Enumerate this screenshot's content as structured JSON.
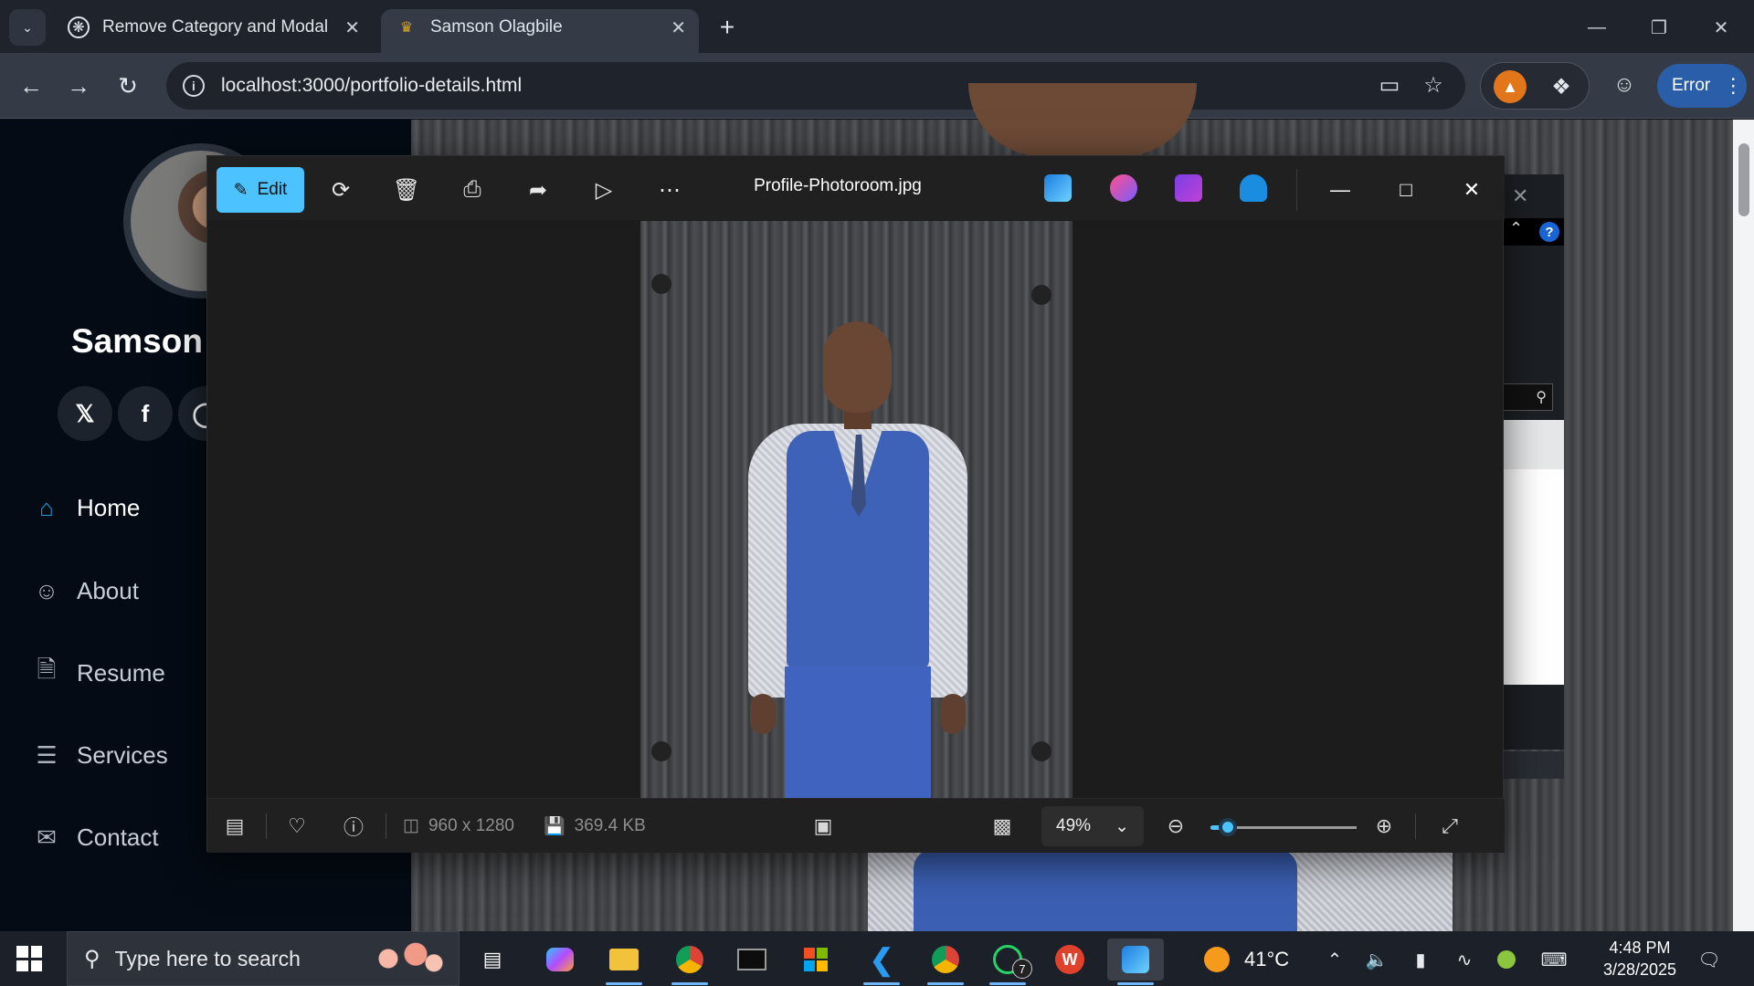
{
  "browser": {
    "tabs": [
      {
        "title": "Remove Category and Modal",
        "favicon": "openai-icon",
        "active": false
      },
      {
        "title": "Samson Olagbile",
        "favicon": "crown-icon",
        "active": true
      }
    ],
    "url": "localhost:3000/portfolio-details.html",
    "profile_button": "Error"
  },
  "portfolio": {
    "name": "Samson O",
    "nav": [
      {
        "label": "Home",
        "icon": "home-icon",
        "active": true
      },
      {
        "label": "About",
        "icon": "person-icon",
        "active": false
      },
      {
        "label": "Resume",
        "icon": "file-icon",
        "active": false
      },
      {
        "label": "Services",
        "icon": "server-icon",
        "active": false
      },
      {
        "label": "Contact",
        "icon": "envelope-icon",
        "active": false
      }
    ],
    "social": [
      "x-icon",
      "facebook-icon",
      "instagram-icon"
    ]
  },
  "viewer": {
    "edit_label": "Edit",
    "filename": "Profile-Photoroom.jpg",
    "dimensions": "960 x 1280",
    "filesize": "369.4 KB",
    "zoom": "49%",
    "zoom_slider_fraction": 0.12
  },
  "taskbar": {
    "search_placeholder": "Type here to search",
    "temperature": "41°C",
    "time": "4:48 PM",
    "date": "3/28/2025",
    "whatsapp_badge": "7"
  },
  "colors": {
    "accent": "#4cc2ff",
    "nav_active": "#149ddd",
    "error_pill": "#2b5ea8"
  }
}
